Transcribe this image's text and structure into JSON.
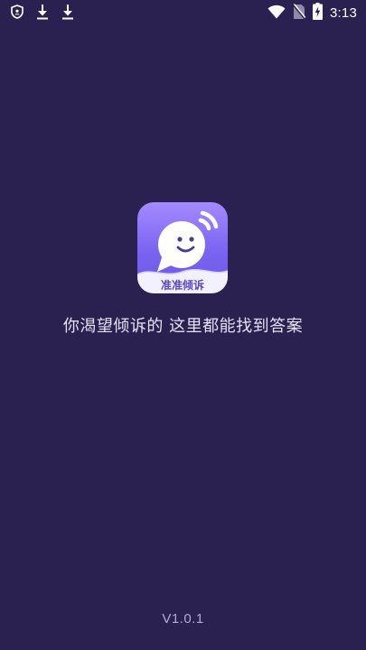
{
  "status_bar": {
    "time": "3:13",
    "icons": [
      "shield-icon",
      "download-icon",
      "download-icon",
      "wifi-icon",
      "no-sim-icon",
      "battery-charging-icon"
    ]
  },
  "splash": {
    "app_icon_label": "准准倾诉",
    "tagline": "你渴望倾诉的 这里都能找到答案",
    "version": "V1.0.1"
  },
  "colors": {
    "background": "#2b2150",
    "icon_gradient_top": "#a48bff",
    "icon_gradient_bottom": "#6b56e6",
    "tagline": "#e6e1f5",
    "version": "#b3a8d6"
  }
}
